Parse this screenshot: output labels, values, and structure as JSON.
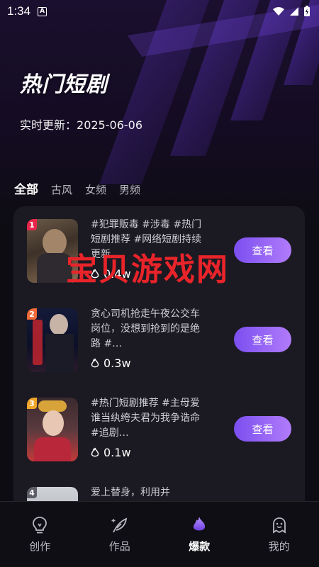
{
  "status_bar": {
    "time": "1:34",
    "app_badge": "A"
  },
  "header": {
    "title": "热门短剧",
    "update_label": "实时更新：",
    "update_date": "2025-06-06"
  },
  "tabs": [
    {
      "label": "全部",
      "active": true
    },
    {
      "label": "古风",
      "active": false
    },
    {
      "label": "女频",
      "active": false
    },
    {
      "label": "男频",
      "active": false
    }
  ],
  "items": [
    {
      "rank": "1",
      "rank_color": "#e8264a",
      "desc": "#犯罪贩毒 #涉毒 #热门短剧推荐 #网络短剧持续更新",
      "heat": "0.4w",
      "button": "查看"
    },
    {
      "rank": "2",
      "rank_color": "#f06a3a",
      "desc": "贪心司机抢走午夜公交车岗位，没想到抢到的是绝路 #…",
      "heat": "0.3w",
      "button": "查看"
    },
    {
      "rank": "3",
      "rank_color": "#f0a72a",
      "desc": "#热门短剧推荐 #主母爱谁当纨绔夫君为我争诰命 #追剧…",
      "heat": "0.1w",
      "button": "查看"
    },
    {
      "rank": "4",
      "rank_color": "#5d5d68",
      "desc": "爱上替身，利用并",
      "heat": "",
      "button": ""
    }
  ],
  "watermark": "宝贝游戏网",
  "bottom_nav": [
    {
      "label": "创作",
      "icon": "bulb-icon",
      "active": false
    },
    {
      "label": "作品",
      "icon": "feather-icon",
      "active": false
    },
    {
      "label": "爆款",
      "icon": "flame-icon",
      "active": true
    },
    {
      "label": "我的",
      "icon": "ghost-icon",
      "active": false
    }
  ],
  "colors": {
    "accent": "#8b5cf6",
    "background": "#0d0c12",
    "card": "#1b1a22"
  }
}
